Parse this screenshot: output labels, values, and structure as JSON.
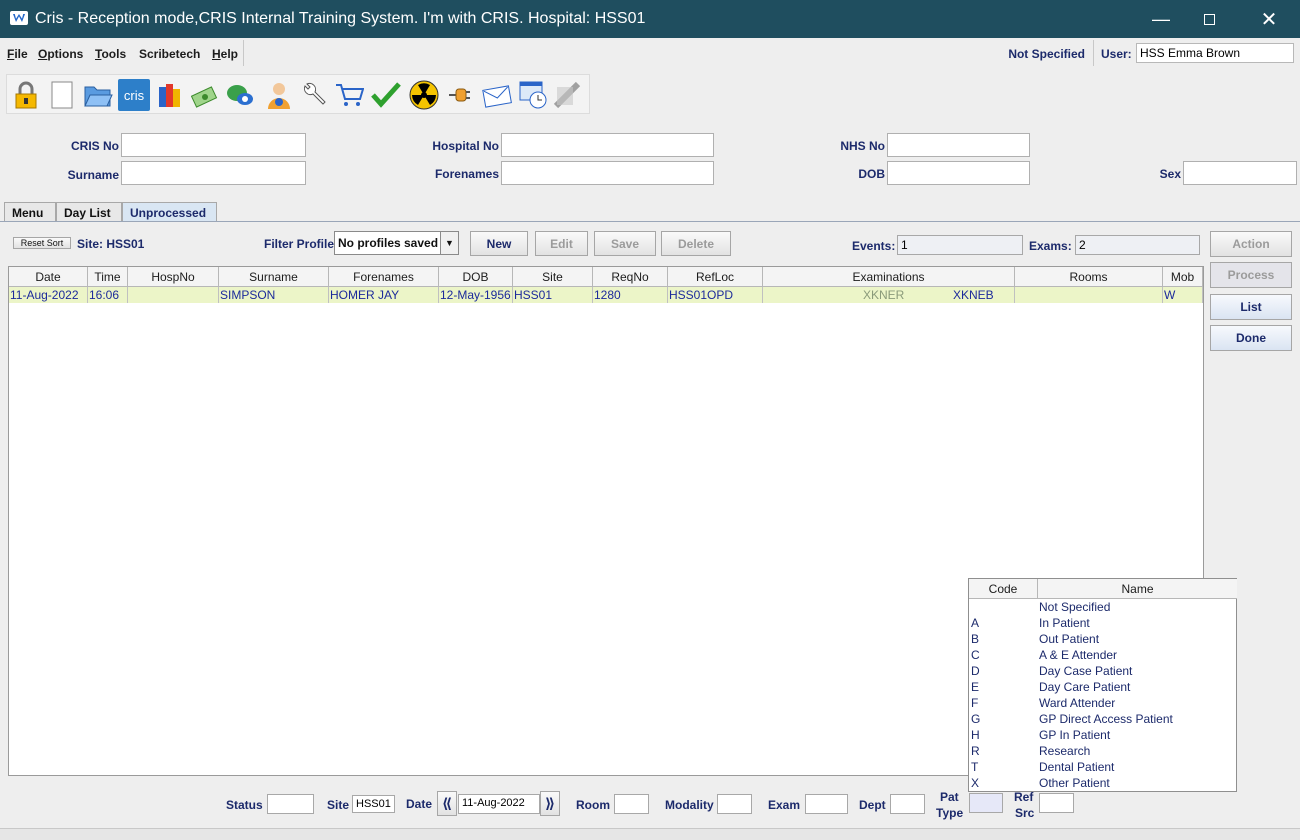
{
  "window": {
    "title": "Cris - Reception mode,CRIS Internal Training System. I'm with CRIS.   Hospital: HSS01"
  },
  "menu": [
    {
      "label": "File",
      "mnemonic": "F",
      "rest": "ile"
    },
    {
      "label": "Options",
      "mnemonic": "O",
      "rest": "ptions"
    },
    {
      "label": "Tools",
      "mnemonic": "T",
      "rest": "ools"
    },
    {
      "label": "Scribetech",
      "mnemonic": "",
      "rest": "Scribetech"
    },
    {
      "label": "Help",
      "mnemonic": "H",
      "rest": "elp"
    }
  ],
  "header": {
    "not_specified": "Not Specified",
    "user_label": "User:",
    "user_value": "HSS Emma Brown"
  },
  "toolbar_icons": [
    "lock-icon",
    "blank-page-icon",
    "open-folder-icon",
    "cris-logo-icon",
    "books-icon",
    "money-icon",
    "chat-icon",
    "person-info-icon",
    "wrench-icon",
    "cart-icon",
    "checkmark-icon",
    "radiation-icon",
    "plug-icon",
    "envelope-icon",
    "clock-window-icon",
    "disabled-tool-icon"
  ],
  "cris_logo_text": "cris",
  "search": {
    "cris_no": "CRIS No",
    "hospital_no": "Hospital No",
    "nhs_no": "NHS No",
    "surname": "Surname",
    "forenames": "Forenames",
    "dob": "DOB",
    "sex": "Sex"
  },
  "tabs": [
    "Menu",
    "Day List",
    "Unprocessed"
  ],
  "controls": {
    "reset_sort": "Reset Sort",
    "site": "Site: HSS01",
    "filter_profile": "Filter Profile",
    "profile_value": "No profiles saved",
    "new": "New",
    "edit": "Edit",
    "save": "Save",
    "delete": "Delete",
    "events_label": "Events:",
    "events_value": "1",
    "exams_label": "Exams:",
    "exams_value": "2"
  },
  "side_buttons": {
    "action": "Action",
    "process": "Process",
    "list": "List",
    "done": "Done"
  },
  "table": {
    "headers": [
      "Date",
      "Time",
      "HospNo",
      "Surname",
      "Forenames",
      "DOB",
      "Site",
      "ReqNo",
      "RefLoc",
      "Examinations",
      "Rooms",
      "Mob"
    ],
    "row": {
      "date": "11-Aug-2022",
      "time": "16:06",
      "hospno": "",
      "surname": "SIMPSON",
      "forenames": "HOMER JAY",
      "dob": "12-May-1956",
      "site": "HSS01",
      "reqno": "1280",
      "refloc": "HSS01OPD",
      "exam1": "XKNER",
      "exam2": "XKNEB",
      "rooms": "",
      "mob": "W"
    }
  },
  "pat_type_popup": {
    "headers": [
      "Code",
      "Name"
    ],
    "rows": [
      {
        "code": "",
        "name": "Not Specified"
      },
      {
        "code": "A",
        "name": "In Patient"
      },
      {
        "code": "B",
        "name": "Out Patient"
      },
      {
        "code": "C",
        "name": "A & E Attender"
      },
      {
        "code": "D",
        "name": "Day Case Patient"
      },
      {
        "code": "E",
        "name": "Day Care Patient"
      },
      {
        "code": "F",
        "name": "Ward Attender"
      },
      {
        "code": "G",
        "name": "GP Direct Access Patient"
      },
      {
        "code": "H",
        "name": "GP In Patient"
      },
      {
        "code": "R",
        "name": "Research"
      },
      {
        "code": "T",
        "name": "Dental Patient"
      },
      {
        "code": "X",
        "name": "Other Patient"
      }
    ]
  },
  "filters": {
    "status": "Status",
    "site": "Site",
    "site_value": "HSS01",
    "date": "Date",
    "date_value": "11-Aug-2022",
    "room": "Room",
    "modality": "Modality",
    "exam": "Exam",
    "dept": "Dept",
    "pat": "Pat",
    "type": "Type",
    "ref": "Ref",
    "src": "Src"
  }
}
